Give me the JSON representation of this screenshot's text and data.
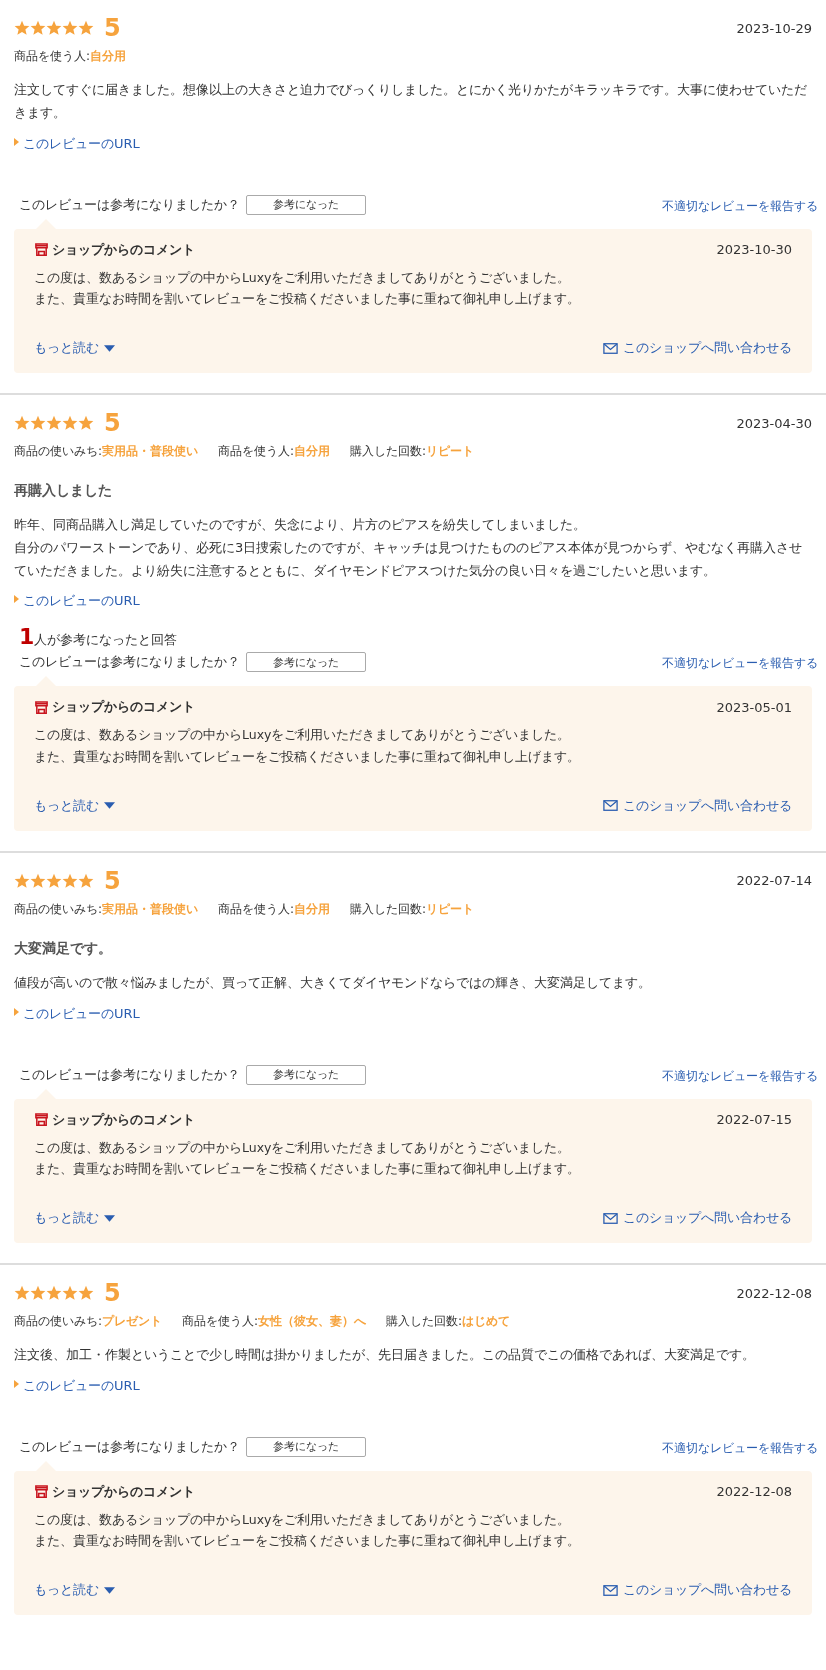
{
  "reviews": [
    {
      "stars": 5,
      "score": "5",
      "date": "2023-10-29",
      "meta": [
        {
          "label": "商品を使う人:",
          "value": "自分用"
        }
      ],
      "body": [
        "注文してすぐに届きました。想像以上の大きさと迫力でびっくりしました。とにかく光りかたがキラッキラです。大事に使わせていただきます。"
      ],
      "url_link": "このレビューのURL",
      "question": "このレビューは参考になりましたか？",
      "helpful_button": "参考になった",
      "report_link": "不適切なレビューを報告する",
      "shop_comment": {
        "title": "ショップからのコメント",
        "date": "2023-10-30",
        "lines": [
          "この度は、数あるショップの中からLuxyをご利用いただきましてありがとうございました。",
          "また、貴重なお時間を割いてレビューをご投稿くださいました事に重ねて御礼申し上げます。"
        ],
        "more": "もっと読む",
        "contact": "このショップへ問い合わせる"
      }
    },
    {
      "stars": 5,
      "score": "5",
      "date": "2023-04-30",
      "meta": [
        {
          "label": "商品の使いみち:",
          "value": "実用品・普段使い"
        },
        {
          "label": "商品を使う人:",
          "value": "自分用"
        },
        {
          "label": "購入した回数:",
          "value": "リピート"
        }
      ],
      "title": "再購入しました",
      "body": [
        "昨年、同商品購入し満足していたのですが、失念により、片方のピアスを紛失してしまいました。",
        "自分のパワーストーンであり、必死に3日捜索したのですが、キャッチは見つけたもののピアス本体が見つからず、やむなく再購入させていただきました。より紛失に注意するとともに、ダイヤモンドピアスつけた気分の良い日々を過ごしたいと思います。"
      ],
      "url_link": "このレビューのURL",
      "helpful_count": "1",
      "helpful_text": "人が参考になったと回答",
      "question": "このレビューは参考になりましたか？",
      "helpful_button": "参考になった",
      "report_link": "不適切なレビューを報告する",
      "shop_comment": {
        "title": "ショップからのコメント",
        "date": "2023-05-01",
        "lines": [
          "この度は、数あるショップの中からLuxyをご利用いただきましてありがとうございました。",
          "また、貴重なお時間を割いてレビューをご投稿くださいました事に重ねて御礼申し上げます。"
        ],
        "more": "もっと読む",
        "contact": "このショップへ問い合わせる"
      }
    },
    {
      "stars": 5,
      "score": "5",
      "date": "2022-07-14",
      "meta": [
        {
          "label": "商品の使いみち:",
          "value": "実用品・普段使い"
        },
        {
          "label": "商品を使う人:",
          "value": "自分用"
        },
        {
          "label": "購入した回数:",
          "value": "リピート"
        }
      ],
      "title": "大変満足です。",
      "body": [
        "値段が高いので散々悩みましたが、買って正解、大きくてダイヤモンドならではの輝き、大変満足してます。"
      ],
      "url_link": "このレビューのURL",
      "question": "このレビューは参考になりましたか？",
      "helpful_button": "参考になった",
      "report_link": "不適切なレビューを報告する",
      "shop_comment": {
        "title": "ショップからのコメント",
        "date": "2022-07-15",
        "lines": [
          "この度は、数あるショップの中からLuxyをご利用いただきましてありがとうございました。",
          "また、貴重なお時間を割いてレビューをご投稿くださいました事に重ねて御礼申し上げます。"
        ],
        "more": "もっと読む",
        "contact": "このショップへ問い合わせる"
      }
    },
    {
      "stars": 5,
      "score": "5",
      "date": "2022-12-08",
      "meta": [
        {
          "label": "商品の使いみち:",
          "value": "プレゼント"
        },
        {
          "label": "商品を使う人:",
          "value": "女性（彼女、妻）へ"
        },
        {
          "label": "購入した回数:",
          "value": "はじめて"
        }
      ],
      "body": [
        "注文後、加工・作製ということで少し時間は掛かりましたが、先日届きました。この品質でこの価格であれば、大変満足です。"
      ],
      "url_link": "このレビューのURL",
      "question": "このレビューは参考になりましたか？",
      "helpful_button": "参考になった",
      "report_link": "不適切なレビューを報告する",
      "shop_comment": {
        "title": "ショップからのコメント",
        "date": "2022-12-08",
        "lines": [
          "この度は、数あるショップの中からLuxyをご利用いただきましてありがとうございました。",
          "また、貴重なお時間を割いてレビューをご投稿くださいました事に重ねて御礼申し上げます。"
        ],
        "more": "もっと読む",
        "contact": "このショップへ問い合わせる"
      }
    }
  ]
}
